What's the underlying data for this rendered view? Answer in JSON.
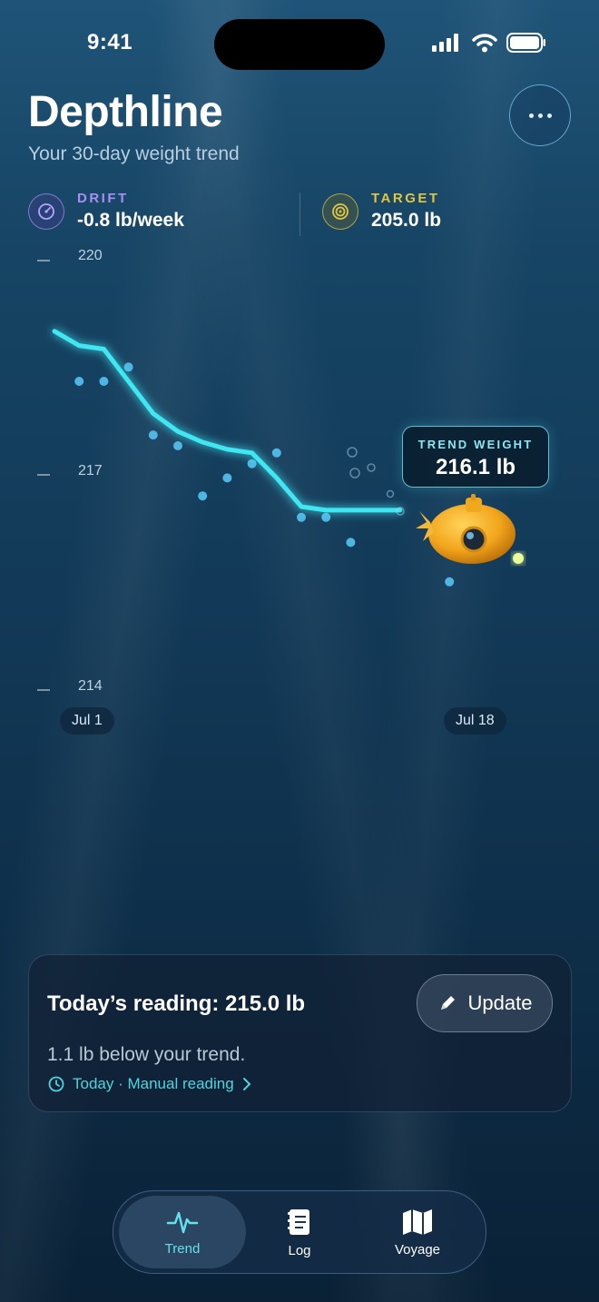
{
  "status_bar": {
    "time": "9:41"
  },
  "app": {
    "title": "Depthline",
    "subtitle": "Your 30-day weight trend"
  },
  "stats": {
    "drift": {
      "label": "DRIFT",
      "value": "-0.8 lb/week",
      "icon": "gauge-icon",
      "color": "#a98ef7"
    },
    "target": {
      "label": "TARGET",
      "value": "205.0 lb",
      "icon": "target-icon",
      "color": "#e2c640"
    }
  },
  "chart_data": {
    "type": "line",
    "y_ticks": [
      "220",
      "217",
      "214"
    ],
    "ylim": [
      214,
      220
    ],
    "x_ticks": [
      "Jul 1",
      "Jul 18"
    ],
    "trend_series": [
      219.0,
      218.8,
      218.75,
      218.3,
      217.85,
      217.6,
      217.45,
      217.35,
      217.3,
      216.95,
      216.55,
      216.5,
      216.5,
      216.5,
      216.5
    ],
    "readings": [
      {
        "day": 1,
        "value": 218.3
      },
      {
        "day": 2,
        "value": 218.3
      },
      {
        "day": 3,
        "value": 218.5
      },
      {
        "day": 4,
        "value": 217.55
      },
      {
        "day": 5,
        "value": 217.4
      },
      {
        "day": 6,
        "value": 216.7
      },
      {
        "day": 7,
        "value": 216.95
      },
      {
        "day": 8,
        "value": 217.15
      },
      {
        "day": 9,
        "value": 217.3
      },
      {
        "day": 10,
        "value": 216.4
      },
      {
        "day": 11,
        "value": 216.4
      },
      {
        "day": 12,
        "value": 216.05
      },
      {
        "day": 16,
        "value": 215.5
      }
    ],
    "trend_color": "#3fe6f2",
    "reading_color": "#4fb6e4"
  },
  "trend_badge": {
    "label": "TREND WEIGHT",
    "value": "216.1 lb"
  },
  "reading_card": {
    "title": "Today’s reading: 215.0 lb",
    "subtitle": "1.1 lb below your trend.",
    "meta": "Today · Manual reading",
    "update_label": "Update"
  },
  "tabs": [
    {
      "label": "Trend",
      "icon": "pulse-icon",
      "active": true
    },
    {
      "label": "Log",
      "icon": "notebook-icon",
      "active": false
    },
    {
      "label": "Voyage",
      "icon": "map-icon",
      "active": false
    }
  ]
}
